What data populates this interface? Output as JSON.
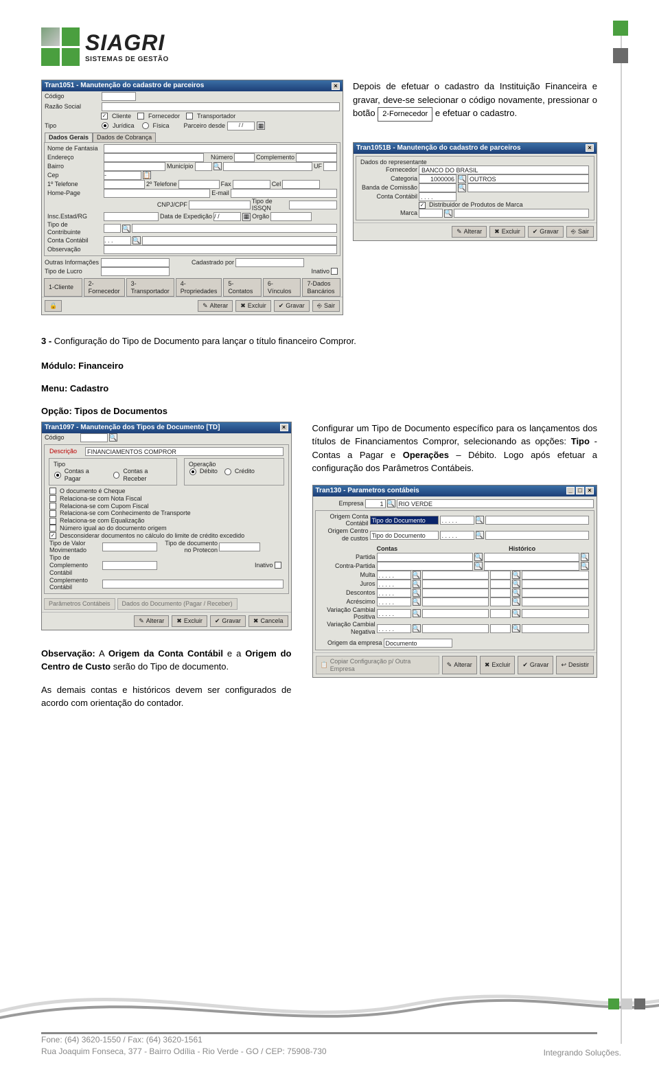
{
  "logo": {
    "name": "SIAGRI",
    "tagline": "SISTEMAS DE GESTÃO"
  },
  "intro": {
    "p1a": "Depois de efetuar o cadastro da Instituição Financeira e gravar, deve-se selecionar o código novamente, pressionar o botão ",
    "btn": "2-Fornecedor",
    "p1b": " e efetuar o cadastro."
  },
  "shot1": {
    "title": "Tran1051 - Manutenção do cadastro de parceiros",
    "labels": {
      "codigo": "Código",
      "razao": "Razão Social",
      "cliente": "Cliente",
      "fornecedor": "Fornecedor",
      "transportador": "Transportador",
      "tipo": "Tipo",
      "juridica": "Jurídica",
      "fisica": "Física",
      "parceiro_desde": "Parceiro desde",
      "data": "/ /",
      "tab_dados": "Dados Gerais",
      "tab_cobranca": "Dados de Cobrança",
      "nome_fantasia": "Nome de Fantasia",
      "endereco": "Endereço",
      "numero": "Número",
      "complemento": "Complemento",
      "bairro": "Bairro",
      "municipio": "Município",
      "uf": "UF",
      "cep": "Cep",
      "tel1": "1º Telefone",
      "tel2": "2º Telefone",
      "fax": "Fax",
      "cel": "Cel",
      "homepage": "Home-Page",
      "email": "E-mail",
      "cnpj": "CNPJ/CPF",
      "tipoissqn": "Tipo de ISSQN",
      "insc": "Insc.Estad/RG",
      "dataexp": "Data de Expedição",
      "orgao": "Orgão",
      "tipocontrib": "Tipo de Contribuinte",
      "contacontabil": "Conta Contábil",
      "obs": "Observação",
      "outras": "Outras Informações",
      "cadastrado": "Cadastrado por",
      "tipolucro": "Tipo de Lucro",
      "inativo": "Inativo"
    },
    "buttons": [
      "1-Cliente",
      "2-Fornecedor",
      "3-Transportador",
      "4-Propriedades",
      "5-Contatos",
      "6-Vínculos",
      "7-Dados Bancários"
    ],
    "actions": [
      "Alterar",
      "Excluir",
      "Gravar",
      "Sair"
    ]
  },
  "shot1b": {
    "title": "Tran1051B - Manutenção do cadastro de parceiros",
    "group": "Dados do representante",
    "fornecedor_lbl": "Fornecedor",
    "fornecedor_val": "BANCO DO BRASIL",
    "categoria_lbl": "Categoria",
    "categoria_val": "1000006",
    "categoria_desc": "OUTROS",
    "banda_lbl": "Banda de Comissão",
    "conta_lbl": "Conta Contábil",
    "conta_val": ". . . .",
    "distrib": "Distribuidor de Produtos de Marca",
    "marca_lbl": "Marca",
    "actions": [
      "Alterar",
      "Excluir",
      "Gravar",
      "Sair"
    ]
  },
  "step3": "3 - Configuração do Tipo de Documento para lançar o título financeiro Compror.",
  "modulo_lbl": "Módulo: ",
  "modulo_val": "Financeiro",
  "menu_lbl": "Menu: ",
  "menu_val": "Cadastro",
  "opcao_lbl": "Opção: ",
  "opcao_val": "Tipos de Documentos",
  "shot2": {
    "title": "Tran1097 - Manutenção dos Tipos de Documento [TD]",
    "codigo": "Código",
    "desc_lbl": "Descrição",
    "desc_val": "FINANCIAMENTOS COMPROR",
    "tipo_group": "Tipo",
    "operacao_group": "Operação",
    "pagar": "Contas a Pagar",
    "receber": "Contas a Receber",
    "debito": "Débito",
    "credito": "Crédito",
    "chks": [
      "O documento é Cheque",
      "Relaciona-se com Nota Fiscal",
      "Relaciona-se com Cupom Fiscal",
      "Relaciona-se com Conhecimento de Transporte",
      "Relaciona-se com Equalização",
      "Número igual ao do documento origem",
      "Desconsiderar documentos no cálculo do limite de crédito excedido"
    ],
    "chk_on": 6,
    "tipovalor": "Tipo de Valor Movimentado",
    "tipodoc": "Tipo de documento no Protecon",
    "tipocompl": "Tipo de Complemento Contábil",
    "inativo": "Inativo",
    "compl": "Complemento Contábil",
    "btns": [
      "Parâmetros Contábeis",
      "Dados do Documento (Pagar / Receber)"
    ],
    "actions": [
      "Alterar",
      "Excluir",
      "Gravar",
      "Cancela"
    ]
  },
  "rightpara": {
    "a": "Configurar um Tipo de Documento específico para os lançamentos dos títulos de Financiamentos Compror, selecionando as opções: ",
    "b": "Tipo",
    "c": " - Contas a Pagar e ",
    "d": "Operações",
    "e": " – Débito. Logo após efetuar a configuração dos Parâmetros Contábeis."
  },
  "shot3": {
    "title": "Tran130 - Parametros contábeis",
    "empresa_lbl": "Empresa",
    "empresa_val": "1",
    "empresa_desc": "RIO VERDE",
    "origem_conta": "Origem Conta Contábil",
    "origem_centro": "Origem Centro de custos",
    "tipo_doc": "Tipo do Documento",
    "contas": "Contas",
    "historico": "Histórico",
    "rows": [
      "Partida",
      "Contra-Partida",
      "Multa",
      "Juros",
      "Descontos",
      "Acréscimo",
      "Variação Cambial Positiva",
      "Variação Cambial Negativa"
    ],
    "origemdoc_lbl": "Origem da empresa",
    "origemdoc_val": "Documento",
    "copy": "Copiar Configuração p/ Outra Empresa",
    "actions": [
      "Alterar",
      "Excluir",
      "Gravar",
      "Desistir"
    ],
    "dotval": ". . . . ."
  },
  "obs": {
    "a": "Observação:",
    "b": " A Origem da Conta Contábil e a Origem do Centro de Custo",
    "c": " serão do Tipo de documento.",
    "d": "As demais contas e históricos devem ser configurados de acordo com orientação do contador."
  },
  "footer": {
    "line1a": "Fone: (64) 3620-1550 / Fax: (64) 3620-1561",
    "line2": "Rua Joaquim Fonseca, 377 - Bairro Odília - Rio Verde - GO / CEP: 75908-730",
    "slogan": "Integrando Soluções."
  }
}
